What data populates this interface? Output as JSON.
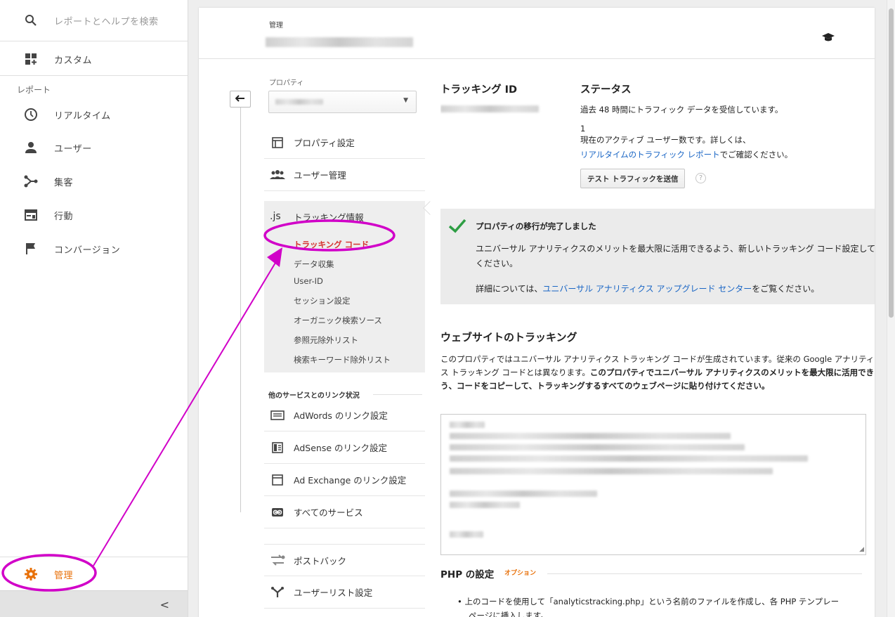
{
  "left_nav": {
    "search_placeholder": "レポートとヘルプを検索",
    "custom": "カスタム",
    "section_reports": "レポート",
    "items": [
      {
        "label": "リアルタイム",
        "icon": "clock-icon"
      },
      {
        "label": "ユーザー",
        "icon": "person-icon"
      },
      {
        "label": "集客",
        "icon": "acquisition-icon"
      },
      {
        "label": "行動",
        "icon": "behavior-icon"
      },
      {
        "label": "コンバージョン",
        "icon": "flag-icon"
      }
    ],
    "admin": "管理",
    "collapse": "<"
  },
  "header": {
    "breadcrumb": "管理",
    "icon": "graduation-cap-icon"
  },
  "property_col": {
    "caption": "プロパティ",
    "settings": "プロパティ設定",
    "user_mgmt": "ユーザー管理",
    "tracking_info": "トラッキング情報",
    "js_label": ".js",
    "sub_items": [
      "トラッキング コード",
      "データ収集",
      "User-ID",
      "セッション設定",
      "オーガニック検索ソース",
      "参照元除外リスト",
      "検索キーワード除外リスト"
    ],
    "link_section": "他のサービスとのリンク状況",
    "links": [
      "AdWords のリンク設定",
      "AdSense のリンク設定",
      "Ad Exchange のリンク設定",
      "すべてのサービス"
    ],
    "postback": "ポストバック",
    "user_list": "ユーザーリスト設定"
  },
  "content": {
    "tracking_id_heading": "トラッキング ID",
    "status_heading": "ステータス",
    "status_line1": "過去 48 時間にトラフィック データを受信しています。",
    "active_count": "1",
    "active_line": "現在のアクティブ ユーザー数です。詳しくは、",
    "realtime_link": "リアルタイムのトラフィック レポート",
    "realtime_suffix": "でご確認ください。",
    "test_button": "テスト トラフィックを送信",
    "help": "?",
    "notice_heading": "プロパティの移行が完了しました",
    "notice_body": "ユニバーサル アナリティクスのメリットを最大限に活用できるよう、新しいトラッキング コード設定してください。",
    "notice_detail_prefix": "詳細については、",
    "notice_detail_link": "ユニバーサル アナリティクス アップグレード センター",
    "notice_detail_suffix": "をご覧ください。",
    "web_heading": "ウェブサイトのトラッキング",
    "web_para_plain": "このプロパティではユニバーサル アナリティクス トラッキング コードが生成されています。従来の Google アナリティクス トラッキング コードとは異なります。",
    "web_para_bold": "このプロパティでユニバーサル アナリティクスのメリットを最大限に活用できるよう、コードをコピーして、トラッキングするすべてのウェブページに貼り付けてください。",
    "php_heading": "PHP の設定",
    "php_option": "オプション",
    "php_bullet": "上のコードを使用して「analyticstracking.php」という名前のファイルを作成し、各 PHP テンプレー",
    "php_bullet2": "ページに挿入します。"
  },
  "colors": {
    "accent_orange": "#e8710a",
    "active_red": "#d5322f",
    "link_blue": "#1a66c5",
    "annotation_magenta": "#d100c8",
    "check_green": "#2e9e44"
  }
}
